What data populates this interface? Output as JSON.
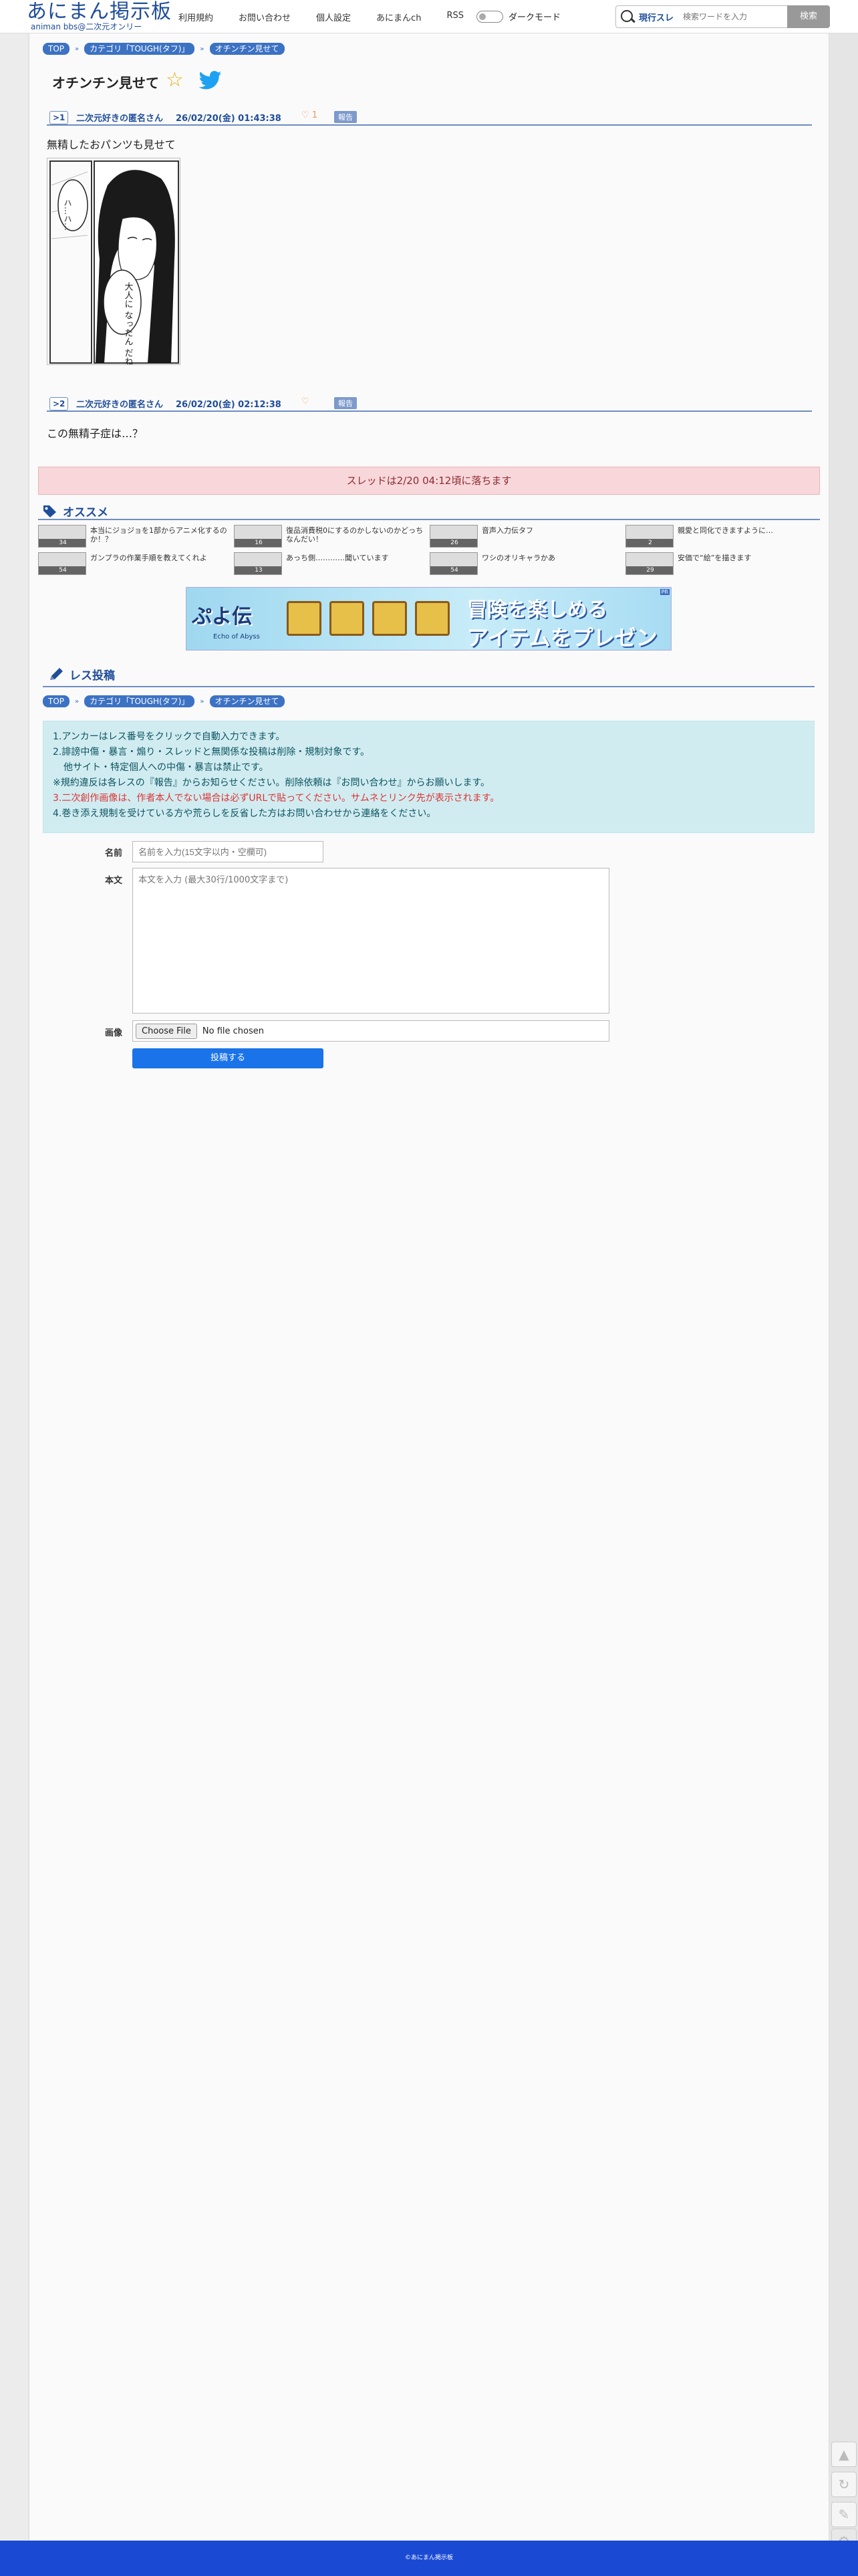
{
  "header": {
    "logo_main": "あにまん掲示板",
    "logo_sub": "animan bbs@二次元オンリー",
    "nav": [
      "利用規約",
      "お問い合わせ",
      "個人設定",
      "あにまんch",
      "RSS"
    ],
    "darkmode_label": "ダークモード",
    "search_scope": "現行スレ",
    "search_placeholder": "検索ワードを入力",
    "search_button": "検索"
  },
  "breadcrumb": [
    "TOP",
    "カテゴリ「TOUGH(タフ)」",
    "オチンチン見せて"
  ],
  "thread_title": "オチンチン見せて",
  "posts": [
    {
      "num": ">1",
      "name": "二次元好きの匿名さん",
      "date": "26/02/20(金) 01:43:38",
      "likes": "1",
      "report": "報告",
      "body": "無精したおパンツも見せて",
      "manga_text_1": "ハ…ハ…",
      "manga_text_2": "大人に なったん だね"
    },
    {
      "num": ">2",
      "name": "二次元好きの匿名さん",
      "date": "26/02/20(金) 02:12:38",
      "likes": "",
      "report": "報告",
      "body": "この無精子症は…？"
    }
  ],
  "notice": "スレッドは2/20 04:12頃に落ちます",
  "recommend": {
    "heading": "オススメ",
    "items": [
      {
        "text": "本当にジョジョを1部からアニメ化するのか！？",
        "count": "34"
      },
      {
        "text": "復品消費税0にするのかしないのかどっちなんだい！",
        "count": "16"
      },
      {
        "text": "音声入力伝タフ",
        "count": "26"
      },
      {
        "text": "親愛と同化できますように…",
        "count": "2"
      },
      {
        "text": "ガンプラの作業手順を教えてくれよ",
        "count": "54"
      },
      {
        "text": "あっち側…………聞いています",
        "count": "13"
      },
      {
        "text": "ワシのオリキャラかあ",
        "count": "54"
      },
      {
        "text": "安価で“絵”を描きます",
        "count": "29"
      }
    ]
  },
  "banner": {
    "logo": "ぷよ伝",
    "logo_sub": "Echo of Abyss",
    "line1": "冒険を楽しめる",
    "line2": "アイテムをプレゼント",
    "tag": "PR"
  },
  "reply": {
    "heading": "レス投稿",
    "rules": [
      "1.アンカーはレス番号をクリックで自動入力できます。",
      "2.誹謗中傷・暴言・煽り・スレッドと無関係な投稿は削除・規制対象です。",
      "他サイト・特定個人への中傷・暴言は禁止です。",
      "※規約違反は各レスの『報告』からお知らせください。削除依頼は『お問い合わせ』からお願いします。",
      "3.二次創作画像は、作者本人でない場合は必ずURLで貼ってください。サムネとリンク先が表示されます。",
      "4.巻き添え規制を受けている方や荒らしを反省した方はお問い合わせから連絡をください。"
    ],
    "name_label": "名前",
    "name_placeholder": "名前を入力(15文字以内・空欄可)",
    "body_label": "本文",
    "body_placeholder": "本文を入力 (最大30行/1000文字まで)",
    "image_label": "画像",
    "file_button": "Choose File",
    "file_status": "No file chosen",
    "submit": "投稿する"
  },
  "footer": "©あにまん掲示板",
  "colors": {
    "brand": "#1f4d9a",
    "accent": "#3c72c4",
    "footer": "#1a4ad3"
  }
}
